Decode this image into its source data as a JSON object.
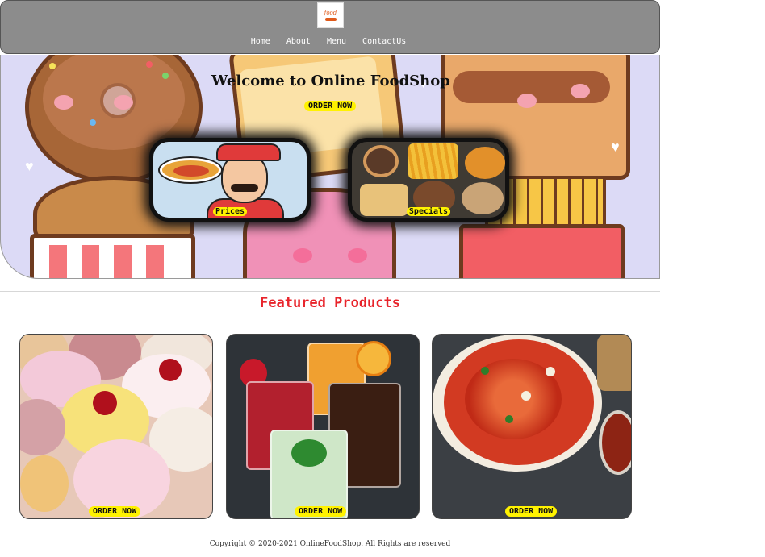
{
  "header": {
    "logo_text": "food",
    "nav": [
      "Home",
      "About",
      "Menu",
      "ContactUs"
    ]
  },
  "hero": {
    "title": "Welcome to Online FoodShop",
    "order_label": "ORDER NOW",
    "cards": [
      {
        "label": "Prices"
      },
      {
        "label": "Specials"
      }
    ]
  },
  "featured": {
    "title": "Featured Products",
    "products": [
      {
        "order_label": "ORDER NOW"
      },
      {
        "order_label": "ORDER NOW"
      },
      {
        "order_label": "ORDER NOW"
      }
    ]
  },
  "footer": {
    "copyright": "Copyright © 2020-2021 OnlineFoodShop. All Rights are reserved"
  },
  "colors": {
    "header_bg": "#8c8c8c",
    "hero_bg": "#dcdaf6",
    "accent_red": "#e8242b",
    "button_yellow": "#fff200"
  }
}
